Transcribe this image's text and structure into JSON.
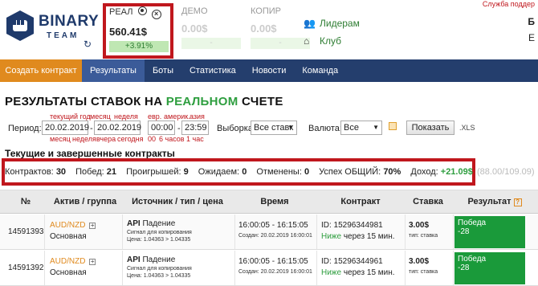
{
  "header": {
    "logo_word": "BINARY",
    "logo_sub": "TEAM",
    "accounts": [
      {
        "name": "РЕАЛ",
        "balance": "560.41$",
        "change": "+3.91%"
      },
      {
        "name": "ДЕМО",
        "balance": "0.00$",
        "change": "-"
      },
      {
        "name": "КОПИР",
        "balance": "0.00$",
        "change": "-"
      }
    ],
    "links": [
      {
        "label": "Лидерам",
        "icon": "people-icon"
      },
      {
        "label": "Клуб",
        "icon": "home-icon"
      }
    ],
    "support": "Служба поддер",
    "login_b": "Б",
    "login_e": "Е"
  },
  "nav": {
    "items": [
      "Создать контракт",
      "Результаты",
      "Боты",
      "Статистика",
      "Новости",
      "Команда"
    ]
  },
  "title": {
    "prefix": "РЕЗУЛЬТАТЫ СТАВОК НА ",
    "highlight": "РЕАЛЬНОМ",
    "suffix": " СЧЕТЕ"
  },
  "filters": {
    "hints_top": [
      "текущий год",
      "месяц",
      "неделя",
      "евр.",
      "америк.",
      "азия"
    ],
    "hints_bottom": [
      "месяц",
      "неделя",
      "вчера",
      "сегодня",
      "00",
      "6 часов",
      "1 час"
    ],
    "period_label": "Период:",
    "date_from": "20.02.2019",
    "date_to": "20.02.2019",
    "time_from": "00:00",
    "time_to": "23:59",
    "selection_label": "Выборка:",
    "selection_value": "Все ставк",
    "currency_label": "Валюта:",
    "currency_value": "Все",
    "show_button": "Показать",
    "xls": ".XLS"
  },
  "section_title": "Текущие и завершенные контракты",
  "stats": {
    "contracts_label": "Контрактов:",
    "contracts": "30",
    "wins_label": "Побед:",
    "wins": "21",
    "losses_label": "Проигрышей:",
    "losses": "9",
    "waiting_label": "Ожидаем:",
    "waiting": "0",
    "cancelled_label": "Отменены:",
    "cancelled": "0",
    "success_label": "Успех ОБЩИЙ:",
    "success": "70%",
    "income_label": "Доход:",
    "income": "+21.09$",
    "tail": "(88.00/109.09)"
  },
  "table": {
    "headers": [
      "№",
      "Актив / группа",
      "Источник / тип / цена",
      "Время",
      "Контракт",
      "Ставка",
      "Результат"
    ],
    "rows": [
      {
        "id": "14591393",
        "asset": "AUD/NZD",
        "group": "Основная",
        "source": "API",
        "type": "Падение",
        "signal": "Сигнал для копирования",
        "price": "Цена: 1.04363 > 1.04335",
        "time": "16:00:05 - 16:15:05",
        "created": "Создан: 20.02.2019 16:00:01",
        "contract_id": "ID: 15296344981",
        "direction": "Ниже",
        "duration": " через 15 мин.",
        "stake": "3.00$",
        "stake_type": "тип: ставка",
        "result": "Победа",
        "result_value": "-28"
      },
      {
        "id": "14591392",
        "asset": "AUD/NZD",
        "group": "Основная",
        "source": "API",
        "type": "Падение",
        "signal": "Сигнал для копирования",
        "price": "Цена: 1.04363 > 1.04335",
        "time": "16:00:05 - 16:15:05",
        "created": "Создан: 20.02.2019 16:00:01",
        "contract_id": "ID: 15296344961",
        "direction": "Ниже",
        "duration": " через 15 мин.",
        "stake": "3.00$",
        "stake_type": "тип: ставка",
        "result": "Победа",
        "result_value": "-28"
      }
    ]
  }
}
